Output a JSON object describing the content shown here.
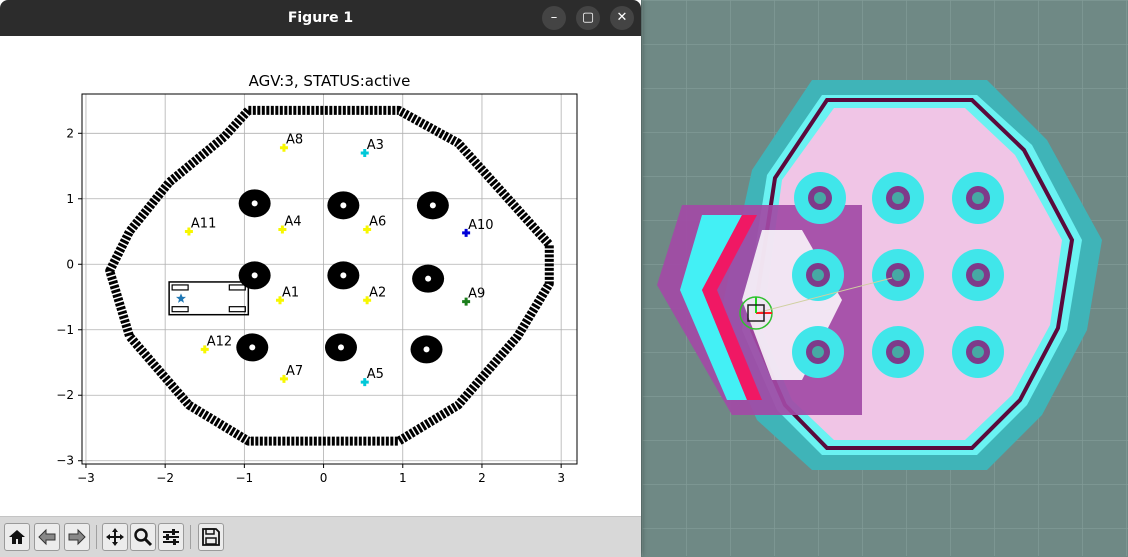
{
  "window": {
    "title": "Figure 1",
    "minimize_glyph": "–",
    "maximize_glyph": "▢",
    "close_glyph": "✕"
  },
  "toolbar": {
    "buttons": [
      {
        "icon": "home-icon"
      },
      {
        "icon": "back-arrow-icon"
      },
      {
        "icon": "forward-arrow-icon"
      },
      {
        "icon": "pan-move-icon"
      },
      {
        "icon": "zoom-magnifier-icon"
      },
      {
        "icon": "configure-subplots-icon"
      },
      {
        "icon": "save-floppy-icon"
      }
    ]
  },
  "chart_data": {
    "type": "scatter",
    "title": "AGV:3, STATUS:active",
    "xlim": [
      -3.05,
      3.2
    ],
    "ylim": [
      -3.05,
      2.6
    ],
    "xticks": [
      -3,
      -2,
      -1,
      0,
      1,
      2,
      3
    ],
    "yticks": [
      2,
      1,
      0,
      -1,
      -2,
      -3
    ],
    "grid": true,
    "boundary_hexagon": [
      [
        -0.95,
        2.35
      ],
      [
        0.95,
        2.35
      ],
      [
        1.7,
        1.85
      ],
      [
        2.85,
        0.3
      ],
      [
        2.85,
        -0.3
      ],
      [
        2.45,
        -1.1
      ],
      [
        1.7,
        -2.15
      ],
      [
        0.95,
        -2.7
      ],
      [
        -0.95,
        -2.7
      ],
      [
        -1.7,
        -2.15
      ],
      [
        -2.45,
        -1.1
      ],
      [
        -2.7,
        -0.1
      ],
      [
        -2.45,
        0.5
      ],
      [
        -1.95,
        1.25
      ],
      [
        -1.25,
        1.95
      ]
    ],
    "obstacles": [
      [
        -0.87,
        0.93
      ],
      [
        0.25,
        0.9
      ],
      [
        1.38,
        0.9
      ],
      [
        -0.87,
        -0.17
      ],
      [
        0.25,
        -0.17
      ],
      [
        1.32,
        -0.22
      ],
      [
        -0.9,
        -1.27
      ],
      [
        0.22,
        -1.27
      ],
      [
        1.3,
        -1.3
      ]
    ],
    "stations": [
      {
        "label": "A1",
        "x": -0.55,
        "y": -0.55,
        "color": "#f7f700"
      },
      {
        "label": "A2",
        "x": 0.55,
        "y": -0.55,
        "color": "#f7f700"
      },
      {
        "label": "A3",
        "x": 0.52,
        "y": 1.7,
        "color": "#00c8d8"
      },
      {
        "label": "A4",
        "x": -0.52,
        "y": 0.53,
        "color": "#f7f700"
      },
      {
        "label": "A5",
        "x": 0.52,
        "y": -1.8,
        "color": "#00c8d8"
      },
      {
        "label": "A6",
        "x": 0.55,
        "y": 0.53,
        "color": "#f7f700"
      },
      {
        "label": "A7",
        "x": -0.5,
        "y": -1.75,
        "color": "#f7f700"
      },
      {
        "label": "A8",
        "x": -0.5,
        "y": 1.78,
        "color": "#f7f700"
      },
      {
        "label": "A9",
        "x": 1.8,
        "y": -0.57,
        "color": "#1a7d1a"
      },
      {
        "label": "A10",
        "x": 1.8,
        "y": 0.48,
        "color": "#0000d8"
      },
      {
        "label": "A11",
        "x": -1.7,
        "y": 0.5,
        "color": "#f7f700"
      },
      {
        "label": "A12",
        "x": -1.5,
        "y": -1.3,
        "color": "#f7f700"
      }
    ],
    "agv": {
      "x": -1.8,
      "y": -0.52,
      "width": 1.0,
      "height": 0.5,
      "color": "#1f77b4"
    }
  }
}
